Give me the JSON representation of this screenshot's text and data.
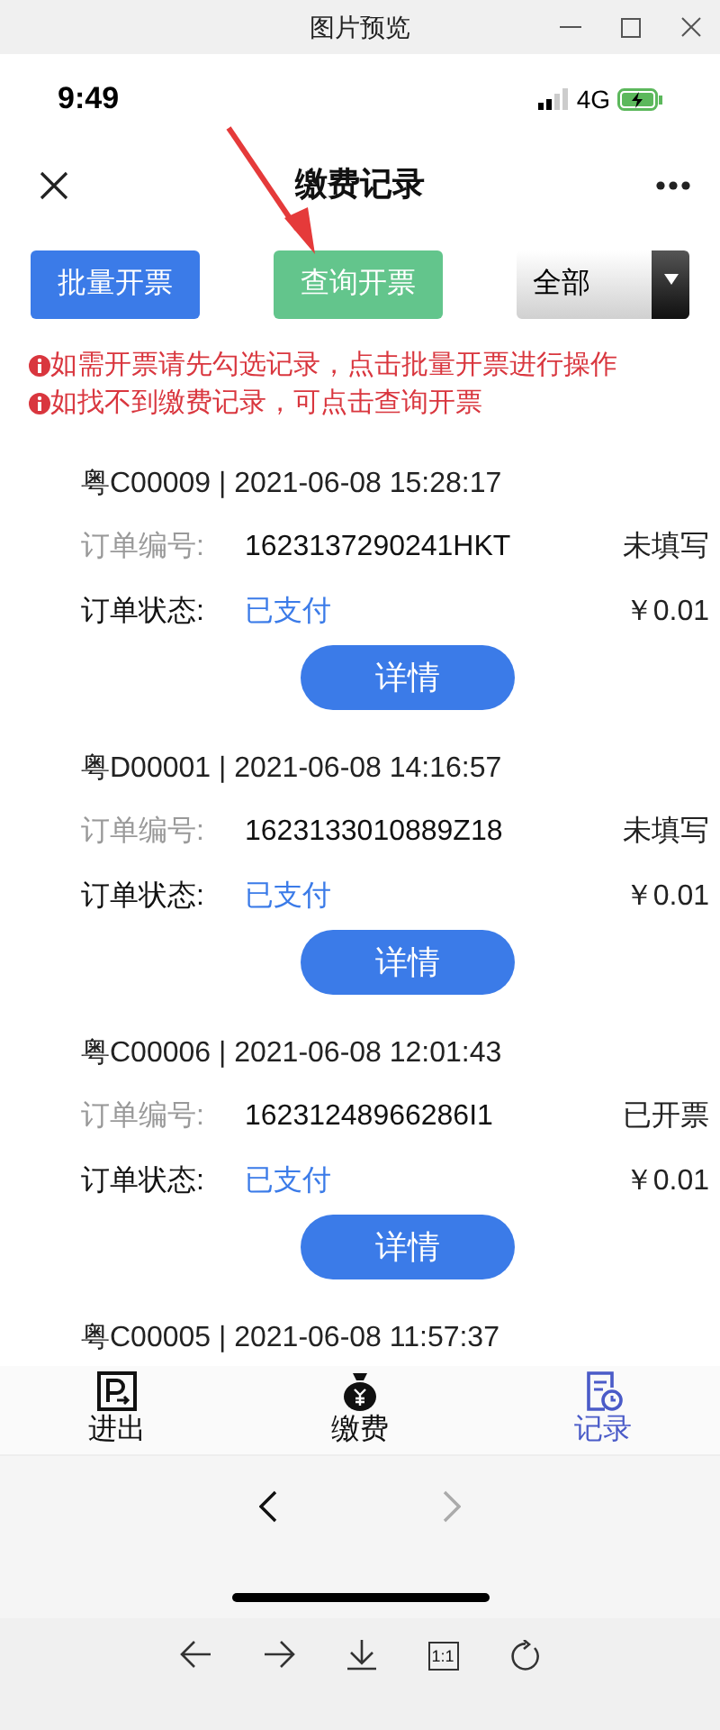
{
  "window": {
    "title": "图片预览"
  },
  "status_bar": {
    "time": "9:49",
    "network": "4G"
  },
  "nav": {
    "title": "缴费记录"
  },
  "actions": [
    {
      "kind": "primary",
      "label": "批量开票"
    },
    {
      "kind": "secondary",
      "label": "查询开票"
    }
  ],
  "filter": {
    "value": "全部"
  },
  "notes": [
    "如需开票请先勾选记录，点击批量开票进行操作",
    "如找不到缴费记录，可点击查询开票"
  ],
  "records": [
    {
      "header": "粤C00009 | 2021-06-08 15:28:17",
      "order_label": "订单编号:",
      "order_no": "1623137290241HKT",
      "invoice_status": "未填写",
      "status_label": "订单状态:",
      "status": "已支付",
      "amount": "￥0.01",
      "button": "详情"
    },
    {
      "header": "粤D00001 | 2021-06-08 14:16:57",
      "order_label": "订单编号:",
      "order_no": "1623133010889Z18",
      "invoice_status": "未填写",
      "status_label": "订单状态:",
      "status": "已支付",
      "amount": "￥0.01",
      "button": "详情"
    },
    {
      "header": "粤C00006 | 2021-06-08 12:01:43",
      "order_label": "订单编号:",
      "order_no": "16231248966286I1",
      "invoice_status": "已开票",
      "status_label": "订单状态:",
      "status": "已支付",
      "amount": "￥0.01",
      "button": "详情"
    },
    {
      "header": "粤C00005 | 2021-06-08 11:57:37"
    }
  ],
  "tabs": [
    {
      "kind": "parking",
      "label": "进出",
      "selected": false
    },
    {
      "kind": "pay",
      "label": "缴费",
      "selected": false
    },
    {
      "kind": "record",
      "label": "记录",
      "selected": true
    }
  ],
  "browser_nav": {
    "back": {
      "disabled": false
    },
    "forward": {
      "disabled": true
    }
  },
  "viewer_toolbar": [
    {
      "kind": "back"
    },
    {
      "kind": "forward"
    },
    {
      "kind": "download"
    },
    {
      "kind": "actual",
      "label": "1:1"
    },
    {
      "kind": "rotate"
    }
  ]
}
